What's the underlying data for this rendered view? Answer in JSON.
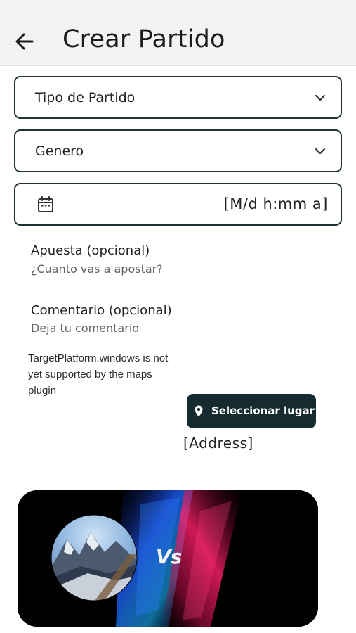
{
  "appbar": {
    "title": "Crear Partido",
    "back_icon": "arrow-left-icon"
  },
  "form": {
    "match_type": {
      "label": "Tipo de Partido",
      "icon": "chevron-down-icon"
    },
    "gender": {
      "label": "Genero",
      "icon": "chevron-down-icon"
    },
    "datetime": {
      "value": "[M/d h:mm a]",
      "icon": "calendar-icon"
    },
    "bet": {
      "label": "Apuesta (opcional)",
      "hint": "¿Cuanto vas a apostar?"
    },
    "comment": {
      "label": "Comentario (opcional)",
      "hint": "Deja tu comentario"
    }
  },
  "map": {
    "notice": "TargetPlatform.windows is not yet supported by the maps plugin",
    "select_place_label": "Seleccionar lugar",
    "select_place_icon": "location-pin-icon",
    "address": "[Address]"
  },
  "banner": {
    "vs_text": "Vs"
  },
  "colors": {
    "primary": "#162b2f",
    "appbar_bg": "#f1f3f5",
    "hint": "#5b6468"
  }
}
